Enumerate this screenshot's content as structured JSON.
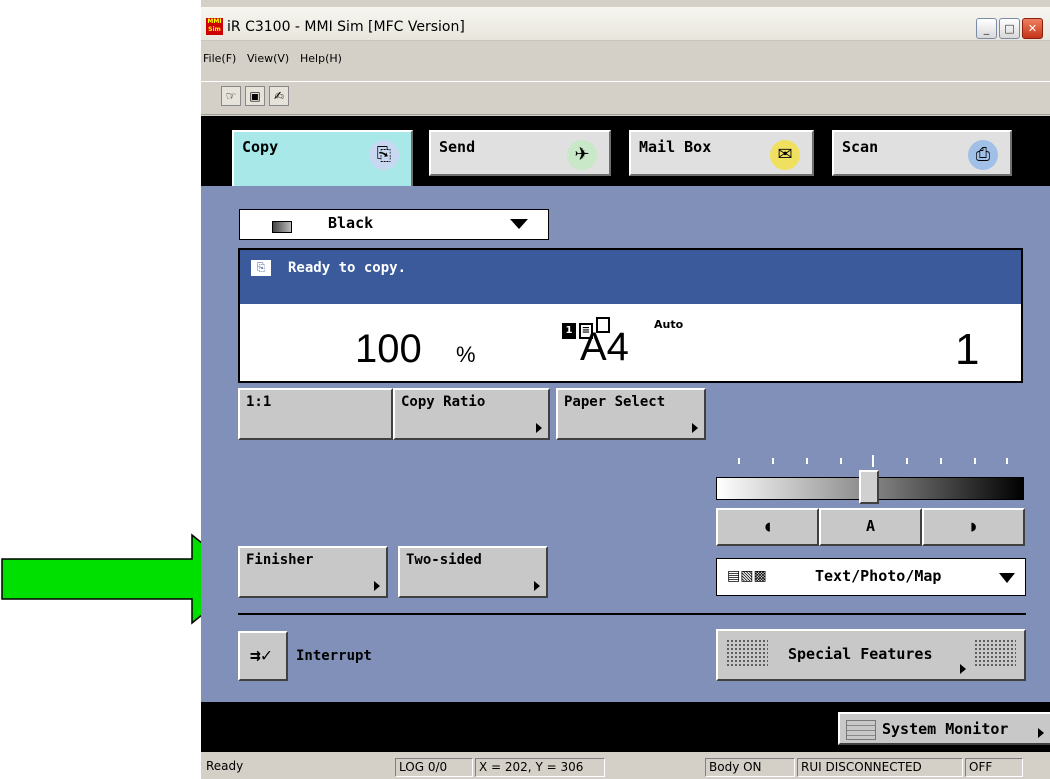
{
  "window": {
    "title": "iR C3100 - MMI Sim [MFC Version]",
    "app_icon_text": "MMI Sim",
    "menu": [
      "File(F)",
      "View(V)",
      "Help(H)"
    ]
  },
  "tabs": [
    {
      "label": "Copy",
      "active": true
    },
    {
      "label": "Send",
      "active": false
    },
    {
      "label": "Mail Box",
      "active": false
    },
    {
      "label": "Scan",
      "active": false
    }
  ],
  "color_select": {
    "value": "Black"
  },
  "status": {
    "message": "Ready to copy.",
    "ratio": "100",
    "ratio_unit": "%",
    "paper_mode": "Auto",
    "paper_size": "A4",
    "copies": "1",
    "sides_badge": "1"
  },
  "buttons": {
    "one_to_one": "1:1",
    "copy_ratio": "Copy Ratio",
    "paper_select": "Paper Select",
    "finisher": "Finisher",
    "two_sided": "Two-sided",
    "interrupt": "Interrupt",
    "special_features": "Special Features",
    "system_monitor": "System Monitor"
  },
  "density": {
    "auto_label": "A",
    "level": 0.5
  },
  "image_mode": {
    "value": "Text/Photo/Map"
  },
  "statusbar": {
    "ready": "Ready",
    "log": "LOG 0/0",
    "coords": "X = 202, Y = 306",
    "body": "Body ON",
    "rui": "RUI DISCONNECTED",
    "power": "OFF"
  },
  "colors": {
    "accent_tab": "#a8e8e8",
    "panel_bg": "#8090b8",
    "status_head": "#3a5a9c",
    "arrow": "#00e000"
  }
}
